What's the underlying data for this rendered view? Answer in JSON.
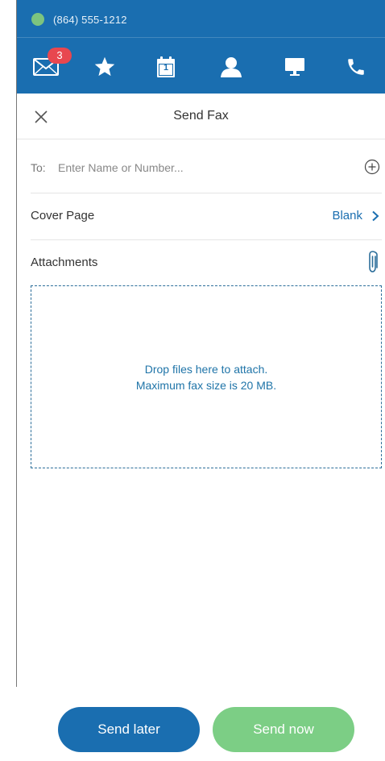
{
  "status": {
    "phone_number": "(864) 555-1212",
    "presence_color": "#7cc47f"
  },
  "nav": {
    "items": [
      {
        "icon": "mail-icon",
        "badge": "3"
      },
      {
        "icon": "star-icon"
      },
      {
        "icon": "calendar-icon",
        "day": "1"
      },
      {
        "icon": "contact-icon"
      },
      {
        "icon": "monitor-icon"
      },
      {
        "icon": "phone-icon"
      }
    ]
  },
  "titlebar": {
    "title": "Send Fax",
    "close_icon": "close-icon"
  },
  "to": {
    "label": "To:",
    "placeholder": "Enter Name or Number...",
    "value": "",
    "add_icon": "add-circle-icon"
  },
  "cover": {
    "label": "Cover Page",
    "value": "Blank"
  },
  "attachments": {
    "label": "Attachments",
    "icon": "paperclip-icon",
    "drop_line1": "Drop files here to attach.",
    "drop_line2": "Maximum fax size is 20 MB."
  },
  "actions": {
    "send_later": "Send later",
    "send_now": "Send now"
  },
  "colors": {
    "header": "#1a6eb0",
    "accent": "#1a6eb0",
    "send_now": "#7cce85",
    "badge": "#e8474f"
  }
}
